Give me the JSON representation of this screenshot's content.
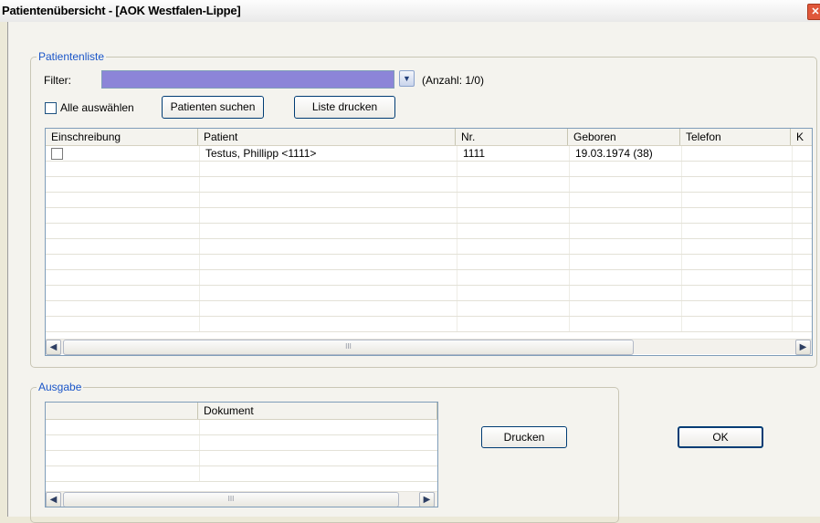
{
  "window": {
    "title": "Patientenübersicht - [AOK Westfalen-Lippe]",
    "close_glyph": "✕"
  },
  "patientenliste": {
    "legend": "Patientenliste",
    "filter_label": "Filter:",
    "filter_value": "",
    "dropdown_glyph": "▼",
    "count_text": "(Anzahl: 1/0)",
    "select_all_label": "Alle auswählen",
    "search_button": "Patienten suchen",
    "print_list_button": "Liste drucken",
    "columns": [
      "Einschreibung",
      "Patient",
      "Nr.",
      "Geboren",
      "Telefon",
      "K"
    ],
    "rows": [
      {
        "checked": false,
        "patient": "Testus,  Phillipp <1111>",
        "nr": "1111",
        "geboren": "19.03.1974 (38)",
        "telefon": "",
        "k": ""
      }
    ],
    "scroll_left_glyph": "◀",
    "scroll_right_glyph": "▶",
    "thumb_grip": "III"
  },
  "ausgabe": {
    "legend": "Ausgabe",
    "columns": [
      "",
      "Dokument"
    ],
    "print_button": "Drucken",
    "scroll_left_glyph": "◀",
    "scroll_right_glyph": "▶",
    "thumb_grip": "III"
  },
  "ok_button": "OK"
}
